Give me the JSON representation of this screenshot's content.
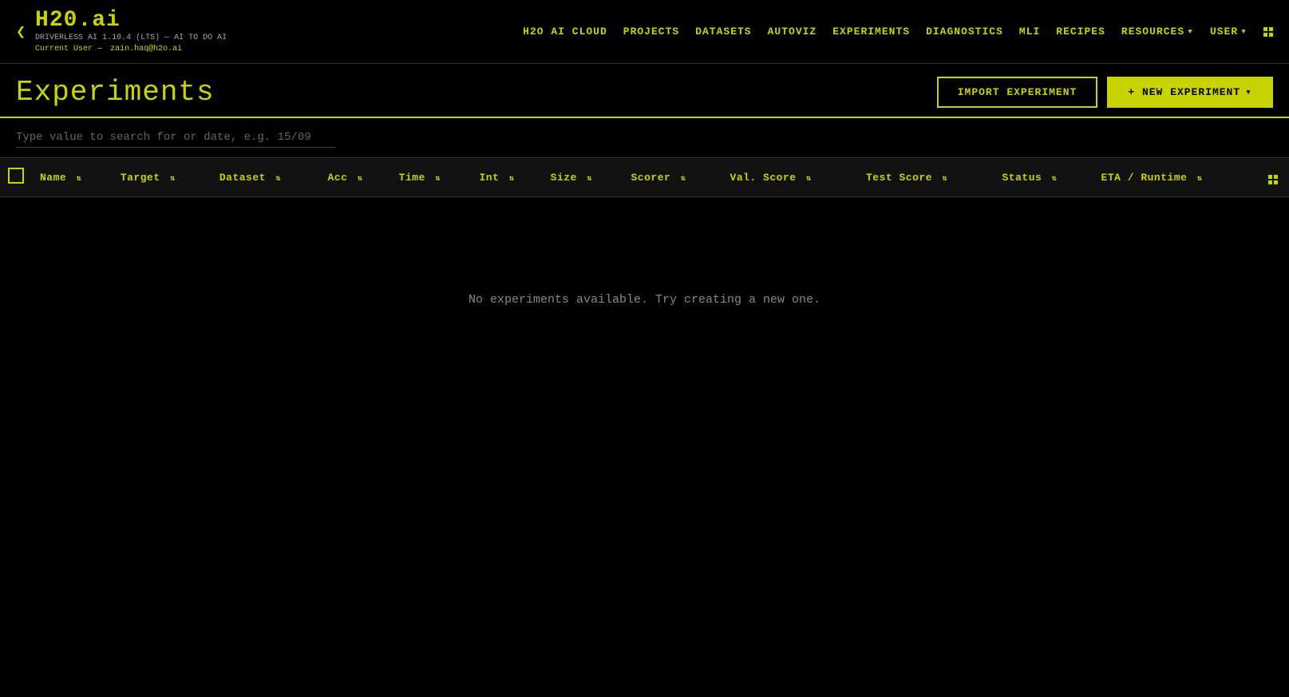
{
  "app": {
    "logo": "H20.ai",
    "chevron": "❮",
    "subtitle_line1": "DRIVERLESS AI 1.10.4 (LTS) — AI TO DO AI",
    "subtitle_line2_prefix": "Current User —",
    "subtitle_line2_user": "zain.haq@h2o.ai"
  },
  "nav": {
    "links": [
      {
        "label": "H2O AI CLOUD",
        "key": "h2o-ai-cloud"
      },
      {
        "label": "PROJECTS",
        "key": "projects"
      },
      {
        "label": "DATASETS",
        "key": "datasets"
      },
      {
        "label": "AUTOVIZ",
        "key": "autoviz"
      },
      {
        "label": "EXPERIMENTS",
        "key": "experiments",
        "active": true
      },
      {
        "label": "DIAGNOSTICS",
        "key": "diagnostics"
      },
      {
        "label": "MLI",
        "key": "mli"
      },
      {
        "label": "RECIPES",
        "key": "recipes"
      },
      {
        "label": "RESOURCES",
        "key": "resources",
        "has_arrow": true
      },
      {
        "label": "USER",
        "key": "user",
        "has_arrow": true
      }
    ]
  },
  "page": {
    "title": "Experiments",
    "import_button_label": "IMPORT EXPERIMENT",
    "new_button_label": "+ NEW EXPERIMENT",
    "new_button_arrow": "▾"
  },
  "search": {
    "placeholder": "Type value to search for or date, e.g. 15/09"
  },
  "table": {
    "columns": [
      {
        "label": "Name",
        "key": "name",
        "sortable": true
      },
      {
        "label": "Target",
        "key": "target",
        "sortable": true
      },
      {
        "label": "Dataset",
        "key": "dataset",
        "sortable": true
      },
      {
        "label": "Acc",
        "key": "acc",
        "sortable": true
      },
      {
        "label": "Time",
        "key": "time",
        "sortable": true
      },
      {
        "label": "Int",
        "key": "int",
        "sortable": true
      },
      {
        "label": "Size",
        "key": "size",
        "sortable": true
      },
      {
        "label": "Scorer",
        "key": "scorer",
        "sortable": true
      },
      {
        "label": "Val. Score",
        "key": "val_score",
        "sortable": true
      },
      {
        "label": "Test Score",
        "key": "test_score",
        "sortable": true
      },
      {
        "label": "Status",
        "key": "status",
        "sortable": true
      },
      {
        "label": "ETA / Runtime",
        "key": "eta_runtime",
        "sortable": true
      }
    ],
    "empty_message": "No experiments available. Try creating a new one.",
    "rows": []
  }
}
